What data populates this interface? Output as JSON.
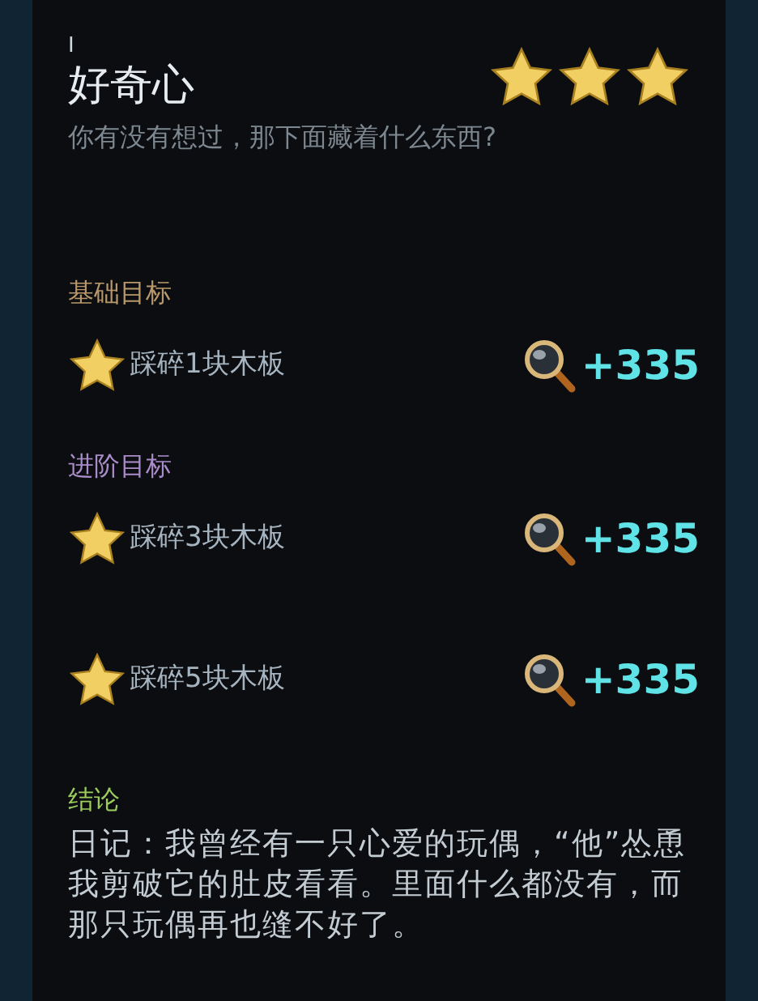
{
  "header": {
    "index": "I",
    "title": "好奇心",
    "subtitle": "你有没有想过，那下面藏着什么东西?",
    "stars": 3
  },
  "sections": [
    {
      "title": "基础目标",
      "color": "#b8986a",
      "goals": [
        {
          "label": "踩碎1块木板",
          "reward": "+335",
          "completed": true
        }
      ]
    },
    {
      "title": "进阶目标",
      "color": "#a98cc8",
      "goals": [
        {
          "label": "踩碎3块木板",
          "reward": "+335",
          "completed": true
        },
        {
          "label": "踩碎5块木板",
          "reward": "+335",
          "completed": true
        }
      ]
    }
  ],
  "conclusion": {
    "title": "结论",
    "text": "日记：我曾经有一只心爱的玩偶，“他”怂恿我剪破它的肚皮看看。里面什么都没有，而那只玩偶再也缝不好了。"
  }
}
